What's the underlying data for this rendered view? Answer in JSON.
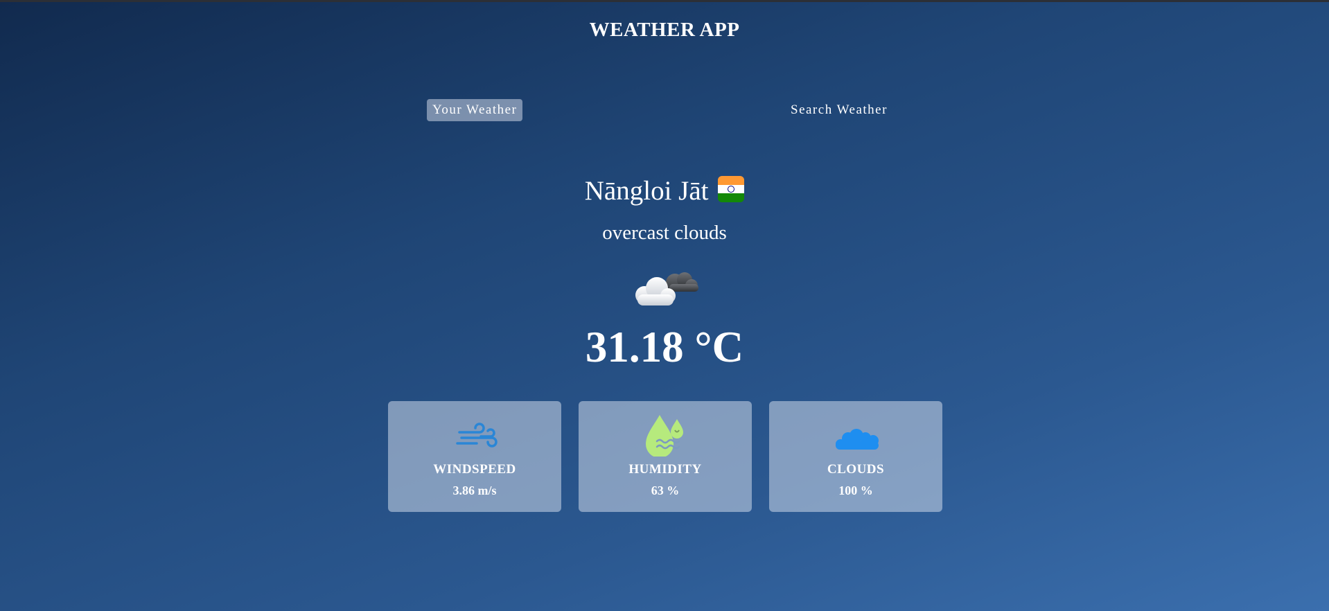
{
  "app": {
    "title": "WEATHER APP"
  },
  "tabs": {
    "your_weather": "Your Weather",
    "search_weather": "Search Weather"
  },
  "location": {
    "city": "Nāngloi Jāt",
    "country_flag": "india-flag-icon"
  },
  "weather": {
    "description": "overcast clouds",
    "icon": "overcast-clouds-icon",
    "temperature": "31.18 °C"
  },
  "stats": {
    "windspeed": {
      "label": "WINDSPEED",
      "value": "3.86 m/s",
      "icon": "wind-icon",
      "color": "#2a86d6"
    },
    "humidity": {
      "label": "HUMIDITY",
      "value": "63 %",
      "icon": "humidity-drop-icon",
      "color": "#b6ea7d"
    },
    "clouds": {
      "label": "CLOUDS",
      "value": "100 %",
      "icon": "clouds-icon",
      "color": "#1e8ef0"
    }
  },
  "colors": {
    "background_start": "#112a4e",
    "background_end": "#3b6fae",
    "active_tab": "#dbe2ef",
    "card": "#ced8e9"
  }
}
